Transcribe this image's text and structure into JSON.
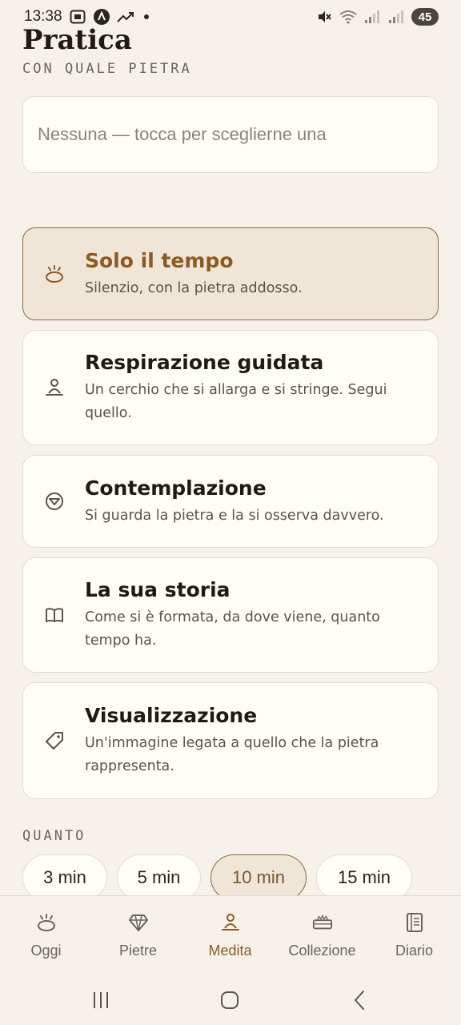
{
  "status_bar": {
    "time": "13:38",
    "battery": "45"
  },
  "header": {
    "title": "Pratica",
    "stone_label": "CON QUALE PIETRA",
    "stone_placeholder": "Nessuna — tocca per sceglierne una"
  },
  "practices": [
    {
      "title": "Solo il tempo",
      "desc": "Silenzio, con la pietra addosso.",
      "icon": "sun-stone-icon",
      "active": true
    },
    {
      "title": "Respirazione guidata",
      "desc": "Un cerchio che si allarga e si stringe. Segui quello.",
      "icon": "meditation-person-icon",
      "active": false
    },
    {
      "title": "Contemplazione",
      "desc": "Si guarda la pietra e la si osserva davvero.",
      "icon": "gem-circle-icon",
      "active": false
    },
    {
      "title": "La sua storia",
      "desc": "Come si è formata, da dove viene, quanto tempo ha.",
      "icon": "book-icon",
      "active": false
    },
    {
      "title": "Visualizzazione",
      "desc": "Un'immagine legata a quello che la pietra rappresenta.",
      "icon": "tag-icon",
      "active": false
    }
  ],
  "duration": {
    "label": "QUANTO",
    "options": [
      "3 min",
      "5 min",
      "10 min",
      "15 min"
    ],
    "selected": "10 min"
  },
  "bottom_nav": {
    "items": [
      {
        "label": "Oggi",
        "icon": "sun-stone-icon"
      },
      {
        "label": "Pietre",
        "icon": "diamond-icon"
      },
      {
        "label": "Medita",
        "icon": "meditation-person-icon"
      },
      {
        "label": "Collezione",
        "icon": "tray-icon"
      },
      {
        "label": "Diario",
        "icon": "journal-icon"
      }
    ],
    "active": "Medita"
  },
  "colors": {
    "background": "#f6f1ea",
    "accent": "#8f5a22",
    "card": "#fffdf8",
    "active_card": "#f0e6d8"
  }
}
